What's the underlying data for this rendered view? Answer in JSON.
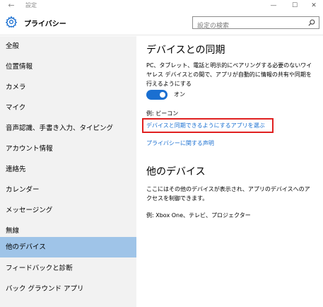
{
  "window": {
    "title": "設定",
    "back_glyph": "←",
    "min_glyph": "—",
    "max_glyph": "☐",
    "close_glyph": "✕"
  },
  "header": {
    "title": "プライバシー",
    "search_placeholder": "設定の検索"
  },
  "sidebar": {
    "items": [
      {
        "label": "全般"
      },
      {
        "label": "位置情報"
      },
      {
        "label": "カメラ"
      },
      {
        "label": "マイク"
      },
      {
        "label": "音声認識、手書き入力、タイピング"
      },
      {
        "label": "アカウント情報"
      },
      {
        "label": "連絡先"
      },
      {
        "label": "カレンダー"
      },
      {
        "label": "メッセージング"
      },
      {
        "label": "無線"
      },
      {
        "label": "他のデバイス"
      },
      {
        "label": "フィードバックと診断"
      },
      {
        "label": "バック グラウンド アプリ"
      }
    ],
    "selected_index": 10
  },
  "main": {
    "sync": {
      "heading": "デバイスとの同期",
      "description": "PC、タブレット、電話と明示的にペアリングする必要のないワイヤレス デバイスとの間で、アプリが自動的に情報の共有や同期を行えるようにする",
      "toggle_on": true,
      "toggle_label": "オン",
      "example": "例: ビーコン",
      "choose_apps_link": "デバイスと同期できるようにするアプリを選ぶ",
      "privacy_link": "プライバシーに関する声明"
    },
    "other_devices": {
      "heading": "他のデバイス",
      "description": "ここにはその他のデバイスが表示され、アプリのデバイスへのアクセスを制御できます。",
      "example": "例: Xbox One、テレビ、プロジェクター"
    }
  },
  "colors": {
    "accent": "#1a6fd1",
    "selected_nav": "#9fc4e8",
    "sidebar_bg": "#f2f2f2",
    "highlight_border": "#e02020"
  }
}
